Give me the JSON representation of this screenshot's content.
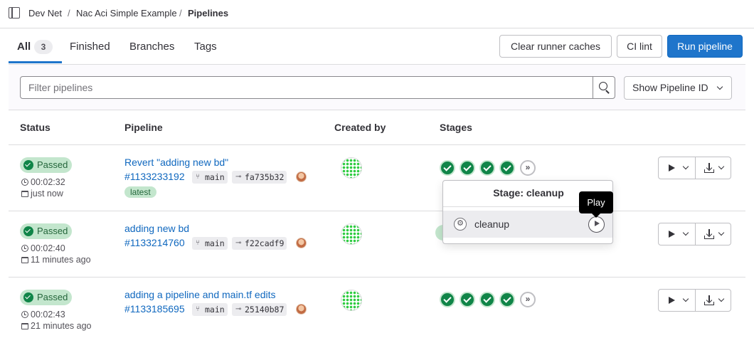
{
  "breadcrumb": {
    "group": "Dev Net",
    "project": "Nac Aci Simple Example",
    "current": "Pipelines",
    "separator": "/"
  },
  "tabs": [
    {
      "label": "All",
      "count": "3",
      "active": true
    },
    {
      "label": "Finished"
    },
    {
      "label": "Branches"
    },
    {
      "label": "Tags"
    }
  ],
  "toolbar": {
    "clear_caches": "Clear runner caches",
    "ci_lint": "CI lint",
    "run_pipeline": "Run pipeline"
  },
  "filter": {
    "placeholder": "Filter pipelines",
    "show_id_label": "Show Pipeline ID"
  },
  "table": {
    "headers": {
      "status": "Status",
      "pipeline": "Pipeline",
      "created_by": "Created by",
      "stages": "Stages"
    },
    "rows": [
      {
        "status": "Passed",
        "duration": "00:02:32",
        "finished": "just now",
        "commit_title": "Revert \"adding new bd\"",
        "pipeline_id": "#1133233192",
        "branch": "main",
        "sha": "fa735b32",
        "tag": "latest"
      },
      {
        "status": "Passed",
        "duration": "00:02:40",
        "finished": "11 minutes ago",
        "commit_title": "adding new bd",
        "pipeline_id": "#1133214760",
        "branch": "main",
        "sha": "f22cadf9"
      },
      {
        "status": "Passed",
        "duration": "00:02:43",
        "finished": "21 minutes ago",
        "commit_title": "adding a pipeline and main.tf edits",
        "pipeline_id": "#1133185695",
        "branch": "main",
        "sha": "25140b87"
      }
    ]
  },
  "stage_dropdown": {
    "title": "Stage: cleanup",
    "job": "cleanup",
    "tooltip": "Play"
  },
  "colors": {
    "accent": "#1f75cb",
    "link": "#1068bf",
    "success": "#108548",
    "success_bg": "#c3e6cd"
  },
  "icons": {
    "skipped_stage": "»",
    "job_gear": "⚙",
    "branch": "⑂",
    "commit": "⊸"
  }
}
